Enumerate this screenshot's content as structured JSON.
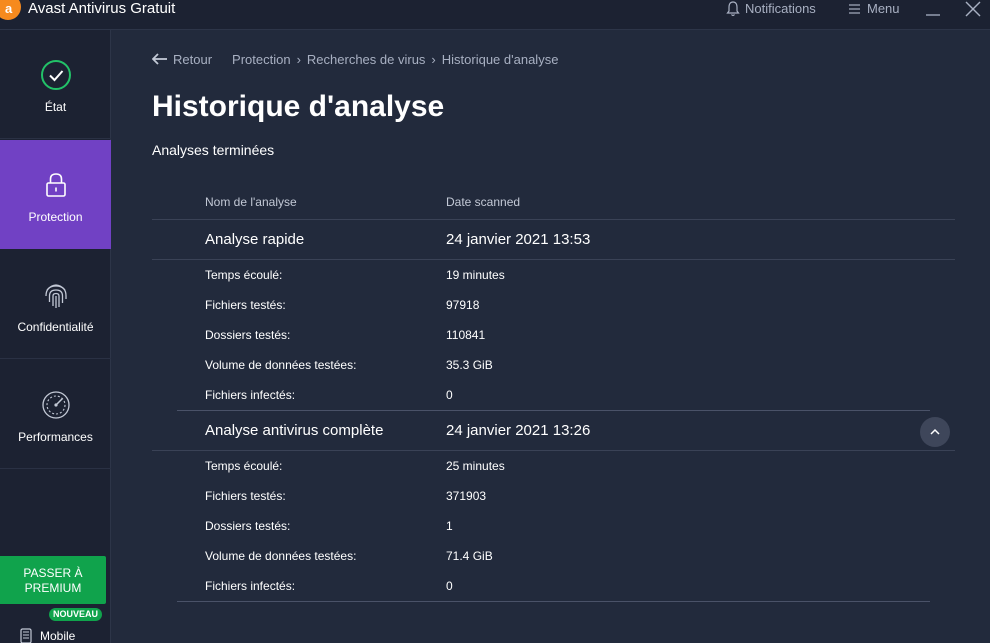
{
  "window": {
    "title": "Avast Antivirus Gratuit",
    "notifications_label": "Notifications",
    "menu_label": "Menu",
    "colors": {
      "accent": "#7141c4",
      "premium": "#10a34c",
      "logo": "#f68a1e"
    }
  },
  "sidebar": {
    "items": [
      {
        "label": "État",
        "icon": "check-circle-icon"
      },
      {
        "label": "Protection",
        "icon": "lock-icon"
      },
      {
        "label": "Confidentialité",
        "icon": "fingerprint-icon"
      },
      {
        "label": "Performances",
        "icon": "speedometer-icon"
      }
    ],
    "premium_line1": "PASSER À",
    "premium_line2": "PREMIUM",
    "new_badge": "NOUVEAU",
    "mobile_label": "Mobile"
  },
  "breadcrumb": {
    "back": "Retour",
    "items": [
      "Protection",
      "Recherches de virus",
      "Historique d'analyse"
    ]
  },
  "page": {
    "title": "Historique d'analyse",
    "subtitle": "Analyses terminées"
  },
  "table": {
    "headers": [
      "Nom de l'analyse",
      "Date scanned"
    ],
    "scans": [
      {
        "name": "Analyse rapide",
        "date": "24 janvier 2021 13:53",
        "details": [
          {
            "label": "Temps écoulé:",
            "value": "19 minutes"
          },
          {
            "label": "Fichiers testés:",
            "value": "97918"
          },
          {
            "label": "Dossiers testés:",
            "value": "110841"
          },
          {
            "label": "Volume de données testées:",
            "value": "35.3 GiB"
          },
          {
            "label": "Fichiers infectés:",
            "value": "0"
          }
        ]
      },
      {
        "name": "Analyse antivirus complète",
        "date": "24 janvier 2021 13:26",
        "details": [
          {
            "label": "Temps écoulé:",
            "value": "25 minutes"
          },
          {
            "label": "Fichiers testés:",
            "value": "371903"
          },
          {
            "label": "Dossiers testés:",
            "value": "1"
          },
          {
            "label": "Volume de données testées:",
            "value": "71.4 GiB"
          },
          {
            "label": "Fichiers infectés:",
            "value": "0"
          }
        ]
      }
    ]
  }
}
